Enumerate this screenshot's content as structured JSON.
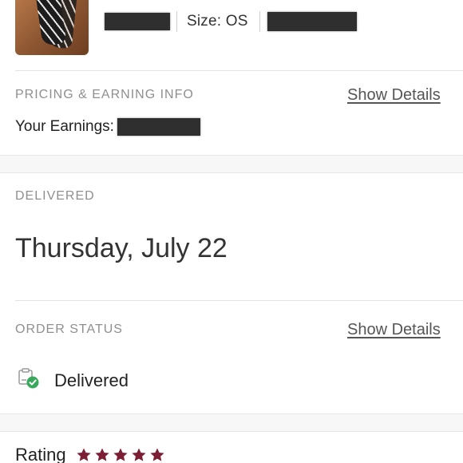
{
  "product": {
    "size_label": "Size: OS"
  },
  "pricing": {
    "section_label": "PRICING & EARNING INFO",
    "details_link": "Show Details",
    "earnings_label": "Your Earnings:"
  },
  "delivery": {
    "section_label": "DELIVERED",
    "date": "Thursday, July 22"
  },
  "order_status": {
    "section_label": "ORDER STATUS",
    "details_link": "Show Details",
    "status_text": "Delivered",
    "status_icon": "delivered-check-icon",
    "status_color": "#3aa85c"
  },
  "rating": {
    "label": "Rating",
    "stars": 5,
    "star_color": "#7c1f34"
  }
}
